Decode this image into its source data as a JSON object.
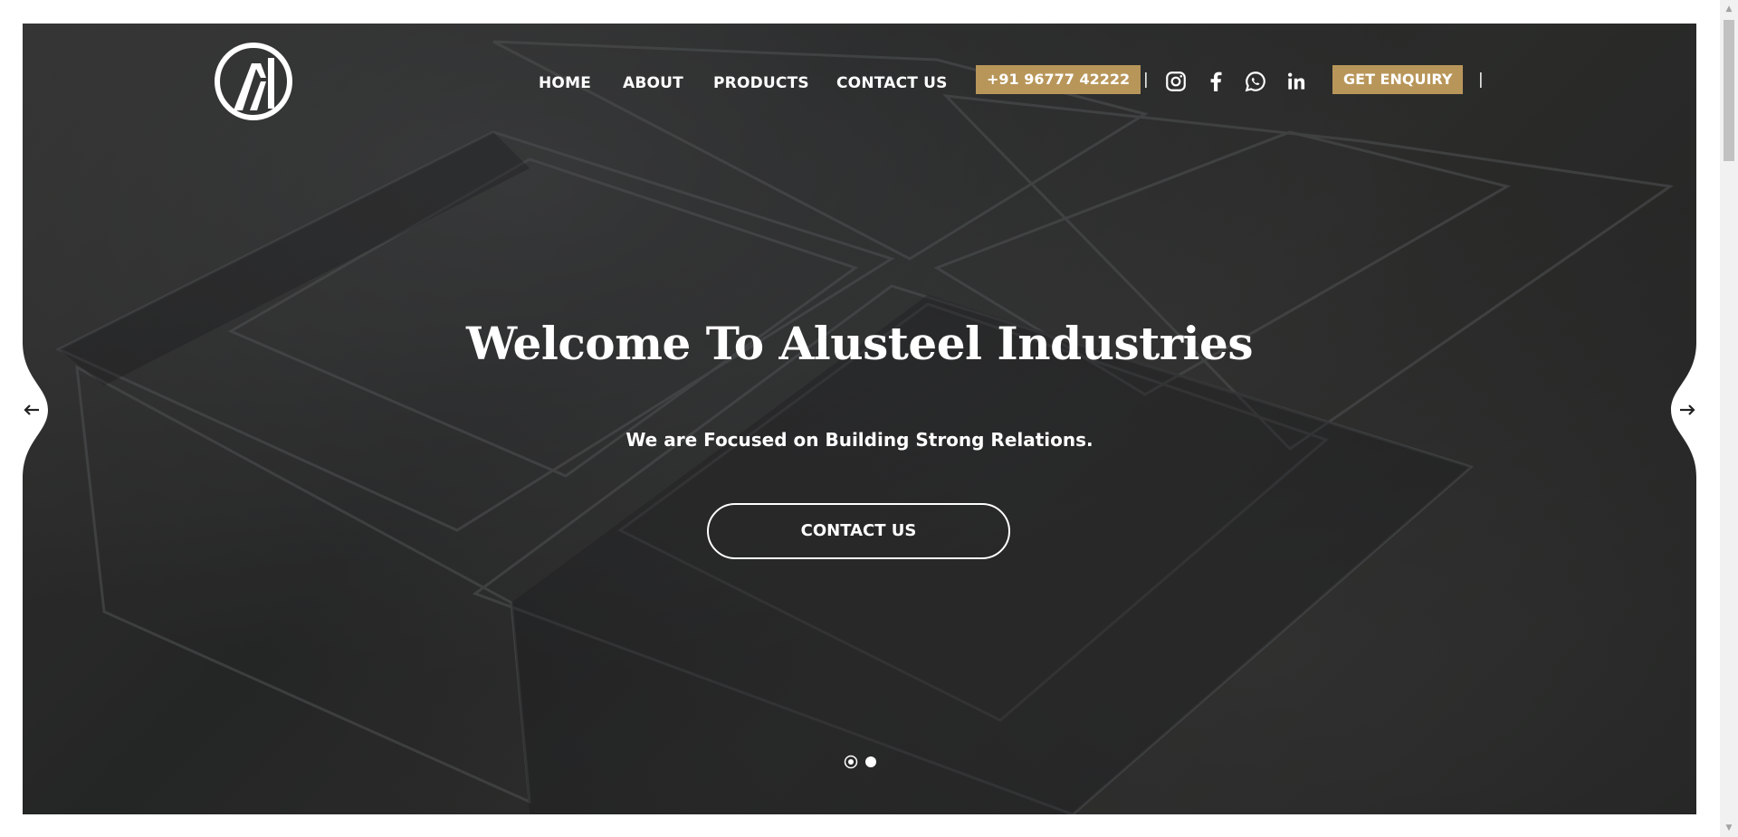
{
  "brand": {
    "logo_icon": "alusteel-logo-icon"
  },
  "nav": {
    "home": "HOME",
    "about": "ABOUT",
    "products": "PRODUCTS",
    "contact": "CONTACT US",
    "phone": "+91 96777 42222",
    "separator": "|",
    "enquiry": "GET ENQUIRY",
    "social_icons": [
      "instagram-icon",
      "facebook-icon",
      "whatsapp-icon",
      "linkedin-icon"
    ]
  },
  "hero": {
    "title": "Welcome To Alusteel Industries",
    "subtitle": "We are Focused on Building Strong Relations.",
    "cta_label": "CONTACT US",
    "slide_count": 2,
    "active_slide": 1,
    "prev_icon": "arrow-left-icon",
    "next_icon": "arrow-right-icon"
  },
  "colors": {
    "accent": "#b8965a",
    "text": "#ffffff",
    "background": "#2e2f2e"
  }
}
